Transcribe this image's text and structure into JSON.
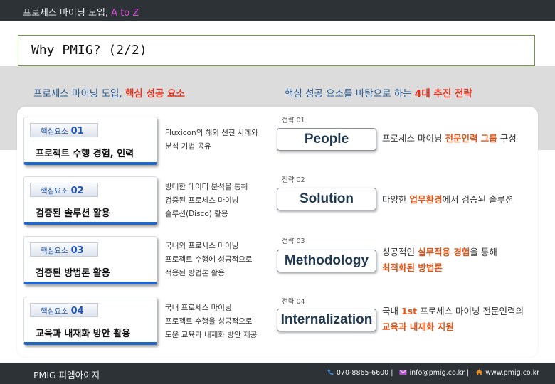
{
  "top_bar": {
    "title_prefix": "프로세스 마이닝 도입, ",
    "title_accent": "A to Z"
  },
  "slide_title": "Why PMIG? (2/2)",
  "left_heading": {
    "text": "프로세스 마이닝 도입, ",
    "highlight": "핵심 성공 요소"
  },
  "right_heading": {
    "text": "핵심 성공 요소를 바탕으로 하는 ",
    "highlight": "4대 추진 전략"
  },
  "factors": [
    {
      "tag": "핵심요소",
      "number": "01",
      "title": "프로젝트 수행 경험, 인력",
      "desc_lines": [
        "Fluxicon의 해외 선진 사례와",
        "분석 기법 공유"
      ]
    },
    {
      "tag": "핵심요소",
      "number": "02",
      "title": "검증된 솔루션 활용",
      "desc_lines": [
        "방대한 데이터 분석을 통해",
        "검증된 프로세스 마이닝",
        "솔루션(Disco) 활용"
      ]
    },
    {
      "tag": "핵심요소",
      "number": "03",
      "title": "검증된 방법론 활용",
      "desc_lines": [
        "국내외 프로세스 마이닝",
        "프로젝트 수행에 성공적으로",
        "적용된 방법론 활용"
      ]
    },
    {
      "tag": "핵심요소",
      "number": "04",
      "title": "교육과 내재화 방안 활용",
      "desc_lines": [
        "국내 프로세스 마이닝",
        "프로젝트 수행을 성공적으로",
        "도운 교육과 내재화 방안 제공"
      ]
    }
  ],
  "strategies": [
    {
      "label": "전략 01",
      "name": "People",
      "line1_a": "프로세스 마이닝 ",
      "line1_hl": "전문인력 그룹",
      "line1_b": " 구성"
    },
    {
      "label": "전략 02",
      "name": "Solution",
      "line1_a": "다양한 ",
      "line1_hl": "업무환경",
      "line1_b": "에서 검증된 솔루션"
    },
    {
      "label": "전략 03",
      "name": "Methodology",
      "line1_a": "성공적인 ",
      "line1_hl": "실무적용 경험",
      "line1_b": "을 통해",
      "line2_hl": "최적화된 방법론"
    },
    {
      "label": "전략 04",
      "name": "Internalization",
      "line1_a": "국내 ",
      "line1_hl": "1st",
      "line1_b": " 프로세스 마이닝 전문인력의",
      "line2_hl": "교육과 내재화 지원"
    }
  ],
  "footer": {
    "brand": "PMIG 피엠아이지",
    "phone": "070-8865-6600",
    "email": "info@pmig.co.kr",
    "website": "www.pmig.co.kr",
    "separator": "|"
  },
  "colors": {
    "accent_red": "#e0321f",
    "accent_orange": "#e0551a",
    "brand_blue": "#2266c8",
    "dark_bar": "#2c3236"
  },
  "icons": {
    "phone": "phone-icon",
    "email": "mail-icon",
    "web": "home-icon"
  }
}
